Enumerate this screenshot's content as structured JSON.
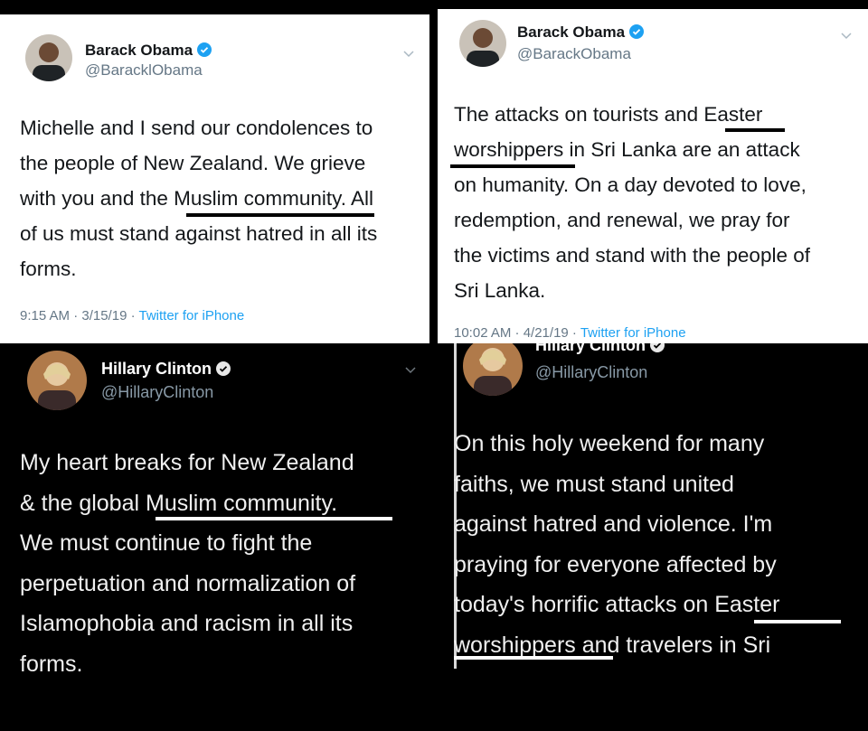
{
  "tweets": [
    {
      "name": "Barack Obama",
      "handle": "@BaracklObama",
      "text_lines": [
        "Michelle and I send our condolences to",
        "the people of New Zealand. We grieve",
        "with you and the Muslim community. All",
        "of us must stand against hatred in all its",
        "forms."
      ],
      "time": "9:15 AM · 3/15/19 · ",
      "source": "Twitter for iPhone"
    },
    {
      "name": "Barack Obama",
      "handle": "@BarackObama",
      "text_lines": [
        "The attacks on tourists and Easter",
        "worshippers in Sri Lanka are an attack",
        "on humanity. On a day devoted to love,",
        "redemption, and renewal, we pray for",
        "the victims and stand with the people of",
        "Sri Lanka."
      ],
      "time": "10:02 AM · 4/21/19 · ",
      "source": "Twitter for iPhone"
    },
    {
      "name": "Hillary Clinton",
      "handle": "@HillaryClinton",
      "text_lines": [
        "My heart breaks for New Zealand",
        "& the global Muslim community.",
        "We must continue to fight the",
        "perpetuation and normalization of",
        "Islamophobia and racism in all its",
        "forms."
      ]
    },
    {
      "name": "Hillary Clinton",
      "handle": "@HillaryClinton",
      "text_lines": [
        "On this holy weekend for many",
        "faiths, we must stand united",
        "against hatred and violence. I'm",
        "praying for everyone affected by",
        "today's horrific attacks on Easter",
        "worshippers and travelers in Sri"
      ]
    }
  ],
  "colors": {
    "verified": "#1da1f2",
    "underline_light": "#000000",
    "underline_dark": "#ffffff"
  },
  "icons": [
    "avatar",
    "verified-badge-icon",
    "chevron-down-icon"
  ]
}
